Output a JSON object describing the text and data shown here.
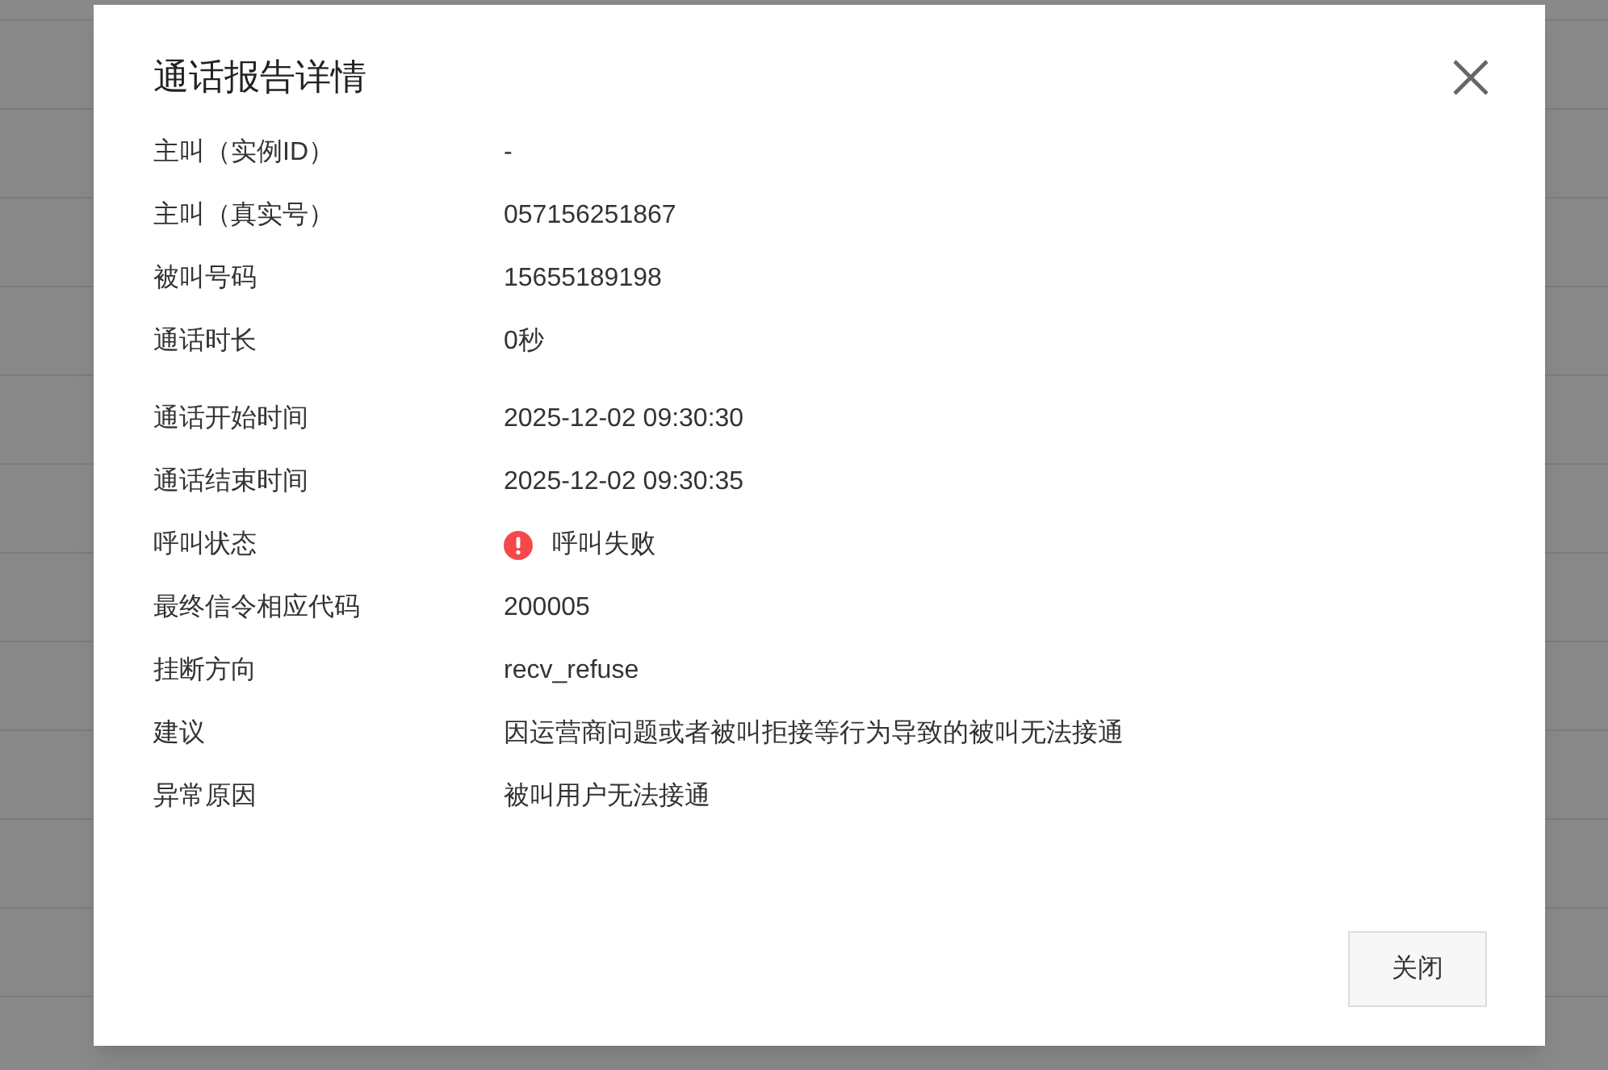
{
  "dialog": {
    "title": "通话报告详情",
    "sections": [
      {
        "fields": [
          {
            "kind": "text",
            "label": "主叫（实例ID）",
            "value": "-"
          },
          {
            "kind": "text",
            "label": "主叫（真实号）",
            "value": "057156251867"
          },
          {
            "kind": "text",
            "label": "被叫号码",
            "value": "15655189198"
          },
          {
            "kind": "text",
            "label": "通话时长",
            "value": "0秒"
          }
        ]
      },
      {
        "fields": [
          {
            "kind": "text",
            "label": "通话开始时间",
            "value": "2025-12-02 09:30:30"
          },
          {
            "kind": "text",
            "label": "通话结束时间",
            "value": "2025-12-02 09:30:35"
          },
          {
            "kind": "error",
            "label": "呼叫状态",
            "value": "呼叫失败"
          },
          {
            "kind": "text",
            "label": "最终信令相应代码",
            "value": "200005"
          },
          {
            "kind": "text",
            "label": "挂断方向",
            "value": "recv_refuse"
          },
          {
            "kind": "text",
            "label": "建议",
            "value": "因运营商问题或者被叫拒接等行为导致的被叫无法接通"
          },
          {
            "kind": "text",
            "label": "异常原因",
            "value": "被叫用户无法接通"
          }
        ]
      }
    ],
    "close_button": "关闭"
  }
}
